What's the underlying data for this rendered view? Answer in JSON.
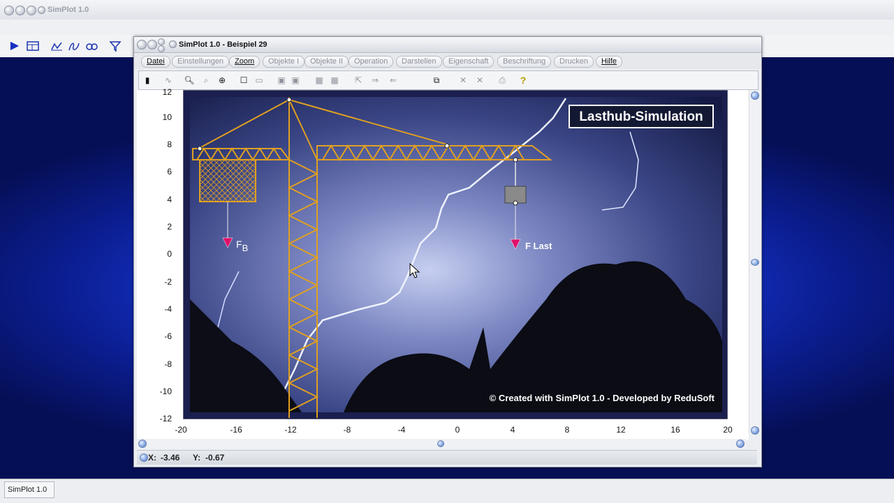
{
  "outer_window": {
    "title": "SimPlot 1.0"
  },
  "inner_window": {
    "title": "SimPlot 1.0 - Beispiel 29",
    "menu": [
      "Datei",
      "Einstellungen",
      "Zoom",
      "Objekte I",
      "Objekte II",
      "Operation",
      "Darstellen",
      "Eigenschaft",
      "Beschriftung",
      "Drucken",
      "Hilfe"
    ],
    "active_menu": [
      "Datei",
      "Zoom",
      "Hilfe"
    ]
  },
  "plot": {
    "title_box": "Lasthub-Simulation",
    "copyright": "© Created with SimPlot 1.0 - Developed by ReduSoft",
    "label_fb_main": "F",
    "label_fb_sub": "B",
    "label_flast": "F Last",
    "x_ticks": [
      "-20",
      "-16",
      "-12",
      "-8",
      "-4",
      "0",
      "4",
      "8",
      "12",
      "16",
      "20"
    ],
    "y_ticks": [
      "12",
      "10",
      "8",
      "6",
      "4",
      "2",
      "0",
      "-2",
      "-4",
      "-6",
      "-8",
      "-10",
      "-12"
    ],
    "xlim": [
      -20,
      20
    ],
    "ylim": [
      -12,
      12
    ]
  },
  "status": {
    "x_label": "X:",
    "x_value": "-3.46",
    "y_label": "Y:",
    "y_value": "-0.67"
  },
  "taskbar": {
    "item": "SimPlot 1.0"
  },
  "colors": {
    "crane": "#e0a020",
    "arrow": "#e0106a",
    "sky": "#2a3670"
  }
}
